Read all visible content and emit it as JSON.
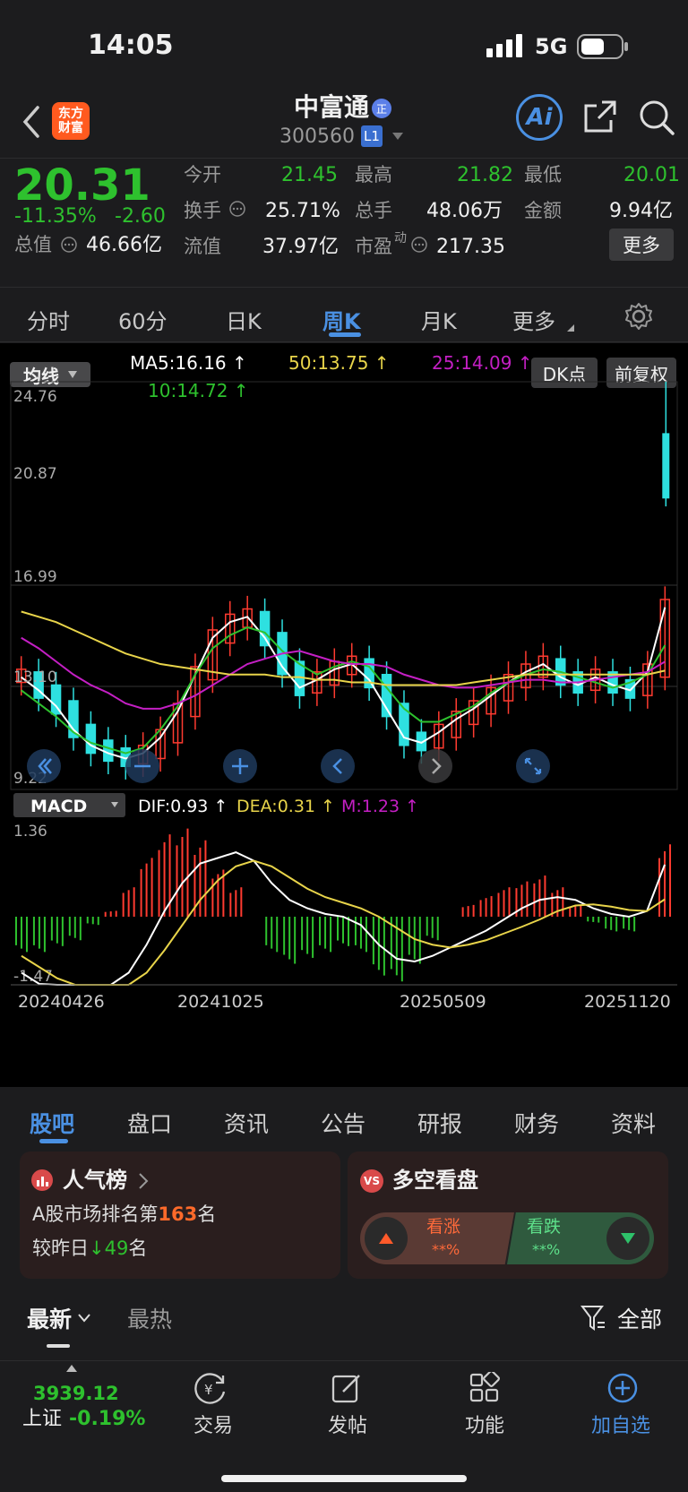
{
  "status": {
    "time": "14:05",
    "network": "5G",
    "battery_level": 0.6
  },
  "header": {
    "back_icon": "chevron-left-icon",
    "logo_text_1": "东方",
    "logo_text_2": "财富",
    "stock_name": "中富通",
    "badge": "正",
    "stock_code": "300560",
    "level": "L1",
    "ai_label": "Ai"
  },
  "quote": {
    "price": "20.31",
    "pct_change": "-11.35%",
    "change": "-2.60",
    "open_label": "今开",
    "open": "21.45",
    "high_label": "最高",
    "high": "21.82",
    "low_label": "最低",
    "low": "20.01",
    "turnover_label": "换手",
    "turnover": "25.71%",
    "volume_label": "总手",
    "volume": "48.06万",
    "amount_label": "金额",
    "amount": "9.94亿",
    "mktcap_label": "总值",
    "mktcap": "46.66亿",
    "float_label": "流值",
    "float": "37.97亿",
    "pe_label": "市盈",
    "pe_sup": "动",
    "pe": "217.35",
    "more_button": "更多"
  },
  "period_tabs": [
    "分时",
    "60分",
    "日K",
    "周K",
    "月K",
    "更多"
  ],
  "active_period": "周K",
  "chart_toolbar": {
    "ma_dropdown": "均线",
    "ma5": "MA5:16.16",
    "ma10": "10:14.72",
    "ma50": "50:13.75",
    "ma25": "25:14.09",
    "dk_button": "DK点",
    "adjust_button": "前复权"
  },
  "price_axis": [
    "24.76",
    "20.87",
    "16.99",
    "13.10",
    "9.22"
  ],
  "macd_toolbar": {
    "dropdown": "MACD",
    "dif": "DIF:0.93",
    "dea": "DEA:0.31",
    "m": "M:1.23",
    "top": "1.36",
    "bottom": "-1.47"
  },
  "date_axis": [
    "20240426",
    "20241025",
    "20250509",
    "20251120"
  ],
  "colors": {
    "up": "#ff3b30",
    "down": "#2ec12e",
    "candle_down": "#2ee0e0",
    "ma5": "#ffffff",
    "ma10": "#2ec12e",
    "ma25": "#c41fc4",
    "ma50": "#e8d44a",
    "accent": "#4a90e2"
  },
  "chart_data": {
    "type": "line",
    "title": "",
    "ylim": [
      9.22,
      24.76
    ],
    "series": [
      {
        "name": "MA5",
        "values": [
          13.5,
          13.0,
          12.4,
          11.5,
          10.9,
          10.6,
          10.4,
          10.6,
          11.2,
          12.2,
          13.6,
          15.0,
          15.6,
          15.8,
          15.0,
          13.9,
          13.1,
          13.4,
          13.8,
          14.0,
          13.4,
          12.3,
          11.2,
          11.0,
          11.4,
          11.9,
          12.3,
          12.8,
          13.3,
          13.7,
          14.0,
          13.5,
          13.2,
          13.5,
          13.2,
          13.0,
          13.7,
          16.16
        ]
      },
      {
        "name": "10",
        "values": [
          13.0,
          12.5,
          12.0,
          11.4,
          11.0,
          10.8,
          10.6,
          10.8,
          11.5,
          12.4,
          13.6,
          14.6,
          15.1,
          15.4,
          15.2,
          14.5,
          14.0,
          13.6,
          13.9,
          14.1,
          13.9,
          13.1,
          12.3,
          11.8,
          11.8,
          12.1,
          12.4,
          12.9,
          13.3,
          13.6,
          13.8,
          13.7,
          13.5,
          13.3,
          13.1,
          13.3,
          13.6,
          14.72
        ]
      },
      {
        "name": "25",
        "values": [
          15.0,
          14.6,
          14.1,
          13.6,
          13.2,
          12.9,
          12.5,
          12.3,
          12.3,
          12.5,
          12.8,
          13.2,
          13.6,
          14.0,
          14.2,
          14.4,
          14.5,
          14.3,
          14.1,
          14.0,
          14.0,
          13.9,
          13.6,
          13.4,
          13.2,
          13.1,
          13.1,
          13.2,
          13.3,
          13.4,
          13.4,
          13.3,
          13.3,
          13.4,
          13.5,
          13.6,
          13.7,
          14.09
        ]
      },
      {
        "name": "50",
        "values": [
          16.0,
          15.8,
          15.6,
          15.3,
          15.0,
          14.7,
          14.4,
          14.2,
          14.0,
          13.9,
          13.8,
          13.7,
          13.6,
          13.6,
          13.6,
          13.5,
          13.5,
          13.4,
          13.4,
          13.3,
          13.3,
          13.2,
          13.2,
          13.2,
          13.2,
          13.2,
          13.3,
          13.4,
          13.5,
          13.6,
          13.6,
          13.6,
          13.6,
          13.6,
          13.6,
          13.6,
          13.6,
          13.75
        ]
      }
    ],
    "macd": {
      "DIF": [
        -1.0,
        -1.2,
        -1.35,
        -1.45,
        -1.42,
        -1.3,
        -1.0,
        -0.5,
        0.1,
        0.6,
        0.95,
        1.05,
        1.15,
        1.0,
        0.6,
        0.3,
        0.15,
        0.05,
        0.0,
        -0.15,
        -0.5,
        -0.75,
        -0.8,
        -0.7,
        -0.55,
        -0.4,
        -0.25,
        -0.05,
        0.15,
        0.3,
        0.35,
        0.3,
        0.15,
        0.05,
        0.0,
        0.1,
        0.93
      ],
      "DEA": [
        -0.7,
        -0.9,
        -1.1,
        -1.25,
        -1.35,
        -1.35,
        -1.25,
        -1.0,
        -0.6,
        -0.15,
        0.3,
        0.65,
        0.9,
        1.0,
        0.9,
        0.7,
        0.5,
        0.35,
        0.25,
        0.15,
        0.0,
        -0.2,
        -0.4,
        -0.5,
        -0.55,
        -0.5,
        -0.42,
        -0.3,
        -0.18,
        -0.05,
        0.1,
        0.2,
        0.22,
        0.18,
        0.12,
        0.1,
        0.31
      ],
      "M": [
        -0.6,
        -0.6,
        -0.5,
        -0.4,
        -0.14,
        0.1,
        0.5,
        1.0,
        1.4,
        1.5,
        1.3,
        0.8,
        0.5,
        0.0,
        -0.6,
        -0.8,
        -0.7,
        -0.6,
        -0.5,
        -0.6,
        -1.0,
        -1.1,
        -0.8,
        -0.4,
        0.0,
        0.2,
        0.35,
        0.5,
        0.6,
        0.7,
        0.5,
        0.2,
        -0.1,
        -0.25,
        -0.25,
        0.0,
        1.23
      ]
    }
  },
  "lower_tabs": [
    "股吧",
    "盘口",
    "资讯",
    "公告",
    "研报",
    "财务",
    "资料"
  ],
  "active_lower_tab": "股吧",
  "popularity_card": {
    "title": "人气榜",
    "rank_prefix": "A股市场排名第",
    "rank": "163",
    "rank_suffix": "名",
    "change_prefix": "较昨日",
    "change": "49",
    "change_suffix": "名"
  },
  "sentiment_card": {
    "title": "多空看盘",
    "badge": "VS",
    "bull_label": "看涨",
    "bull_pct": "**%",
    "bear_label": "看跌",
    "bear_pct": "**%"
  },
  "feed_filters": {
    "latest": "最新",
    "hot": "最热",
    "all": "全部"
  },
  "bottom_nav": {
    "index_value": "3939.12",
    "index_name": "上证",
    "index_change": "-0.19%",
    "trade": "交易",
    "post": "发帖",
    "functions": "功能",
    "add_watch": "加自选"
  }
}
